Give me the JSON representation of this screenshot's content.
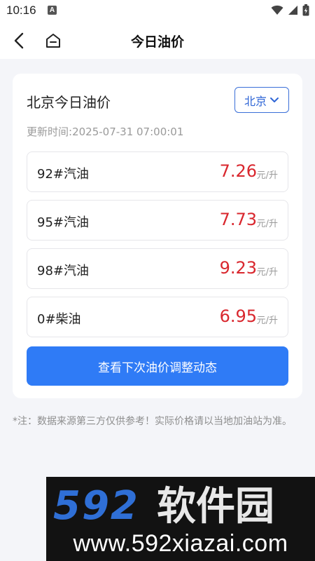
{
  "status_bar": {
    "time": "10:16",
    "notification_letter": "A"
  },
  "header": {
    "title": "今日油价"
  },
  "card": {
    "title": "北京今日油价",
    "city_select": {
      "value": "北京"
    },
    "update": {
      "label": "更新时间:",
      "value": "2025-07-31 07:00:01"
    },
    "prices": [
      {
        "name": "92#汽油",
        "price": "7.26",
        "unit": "元/升"
      },
      {
        "name": "95#汽油",
        "price": "7.73",
        "unit": "元/升"
      },
      {
        "name": "98#汽油",
        "price": "9.23",
        "unit": "元/升"
      },
      {
        "name": "0#柴油",
        "price": "6.95",
        "unit": "元/升"
      }
    ],
    "adjust_button_label": "查看下次油价调整动态"
  },
  "note": "*注：数据来源第三方仅供参考！实际价格请以当地加油站为准。",
  "watermark": {
    "logo_text": "592软件园",
    "url": "www.592xiazai.com"
  },
  "colors": {
    "accent": "#2f7bf6",
    "price": "#d9272e",
    "background": "#f4f5f9"
  },
  "icons": [
    "back-arrow-icon",
    "home-icon",
    "chevron-down-icon",
    "wifi-icon",
    "signal-icon",
    "battery-icon"
  ]
}
